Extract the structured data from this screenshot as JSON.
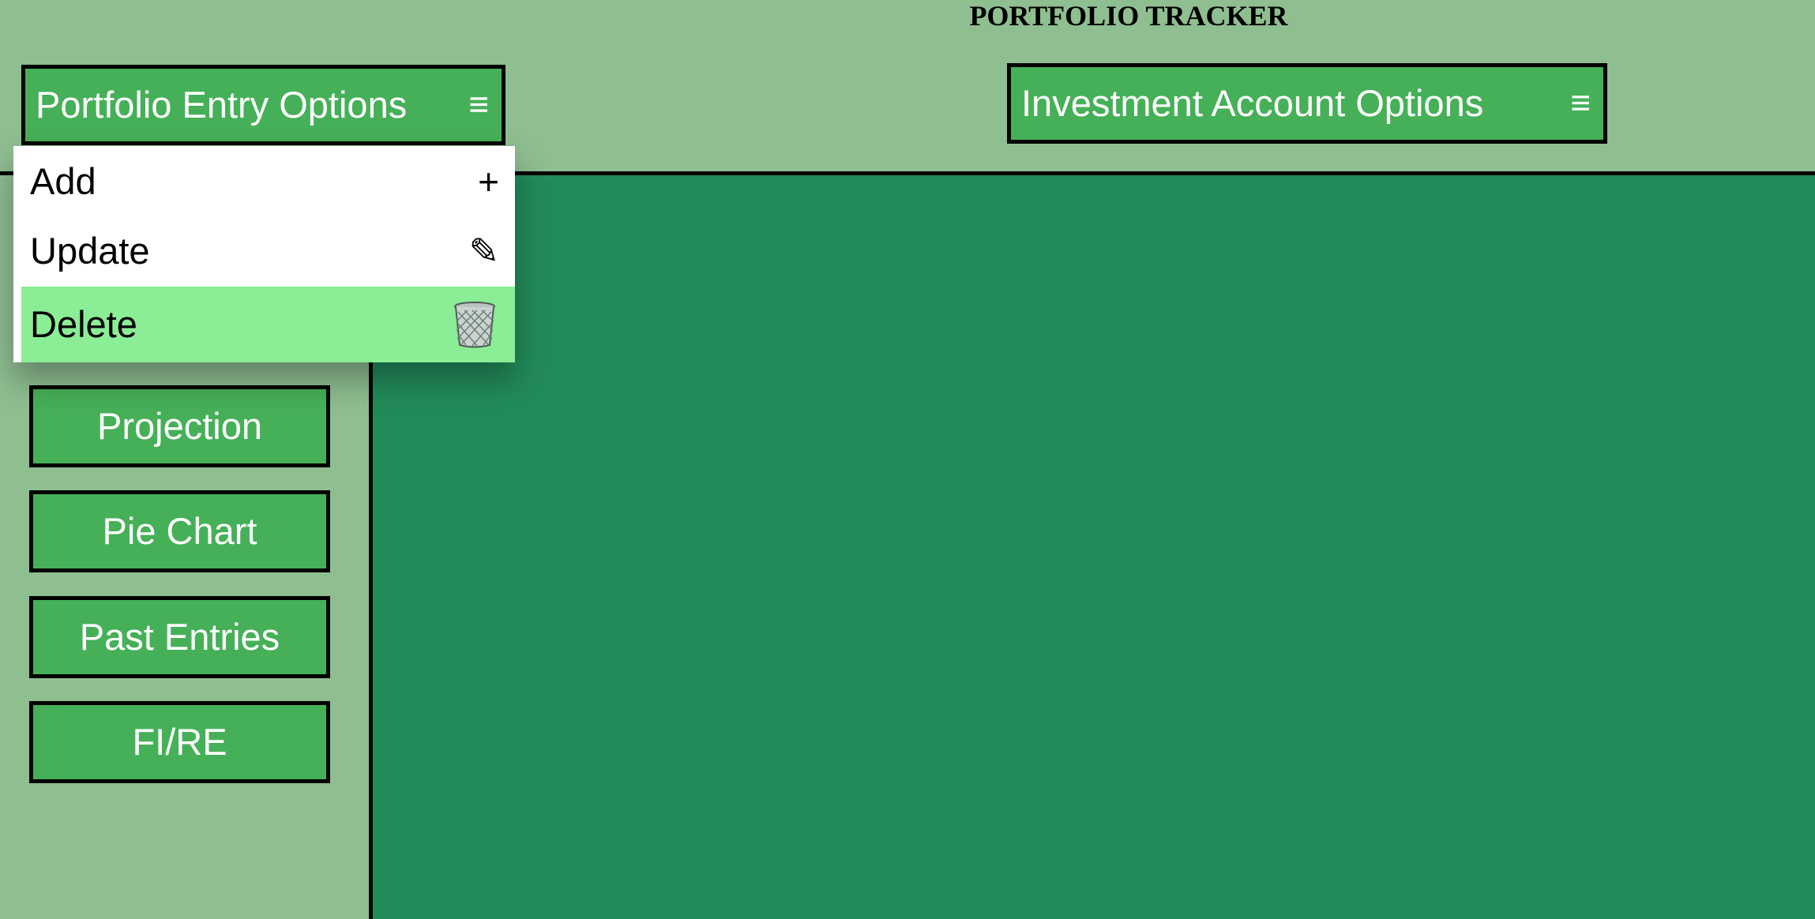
{
  "app": {
    "title": "PORTFOLIO TRACKER"
  },
  "header": {
    "entry_menu_label": "Portfolio Entry Options",
    "account_menu_label": "Investment Account Options",
    "menu_icon": "≡"
  },
  "dropdown": {
    "items": [
      {
        "label": "Add",
        "icon": "+"
      },
      {
        "label": "Update",
        "icon": "✎"
      },
      {
        "label": "Delete",
        "icon": "trash-icon"
      }
    ]
  },
  "sidebar": {
    "buttons": [
      "Projection",
      "Pie Chart",
      "Past Entries",
      "FI/RE"
    ]
  },
  "colors": {
    "page_bg": "#8fbe91",
    "button_green": "#46b058",
    "main_panel": "#228b5a",
    "hover_green": "#8bed96"
  }
}
